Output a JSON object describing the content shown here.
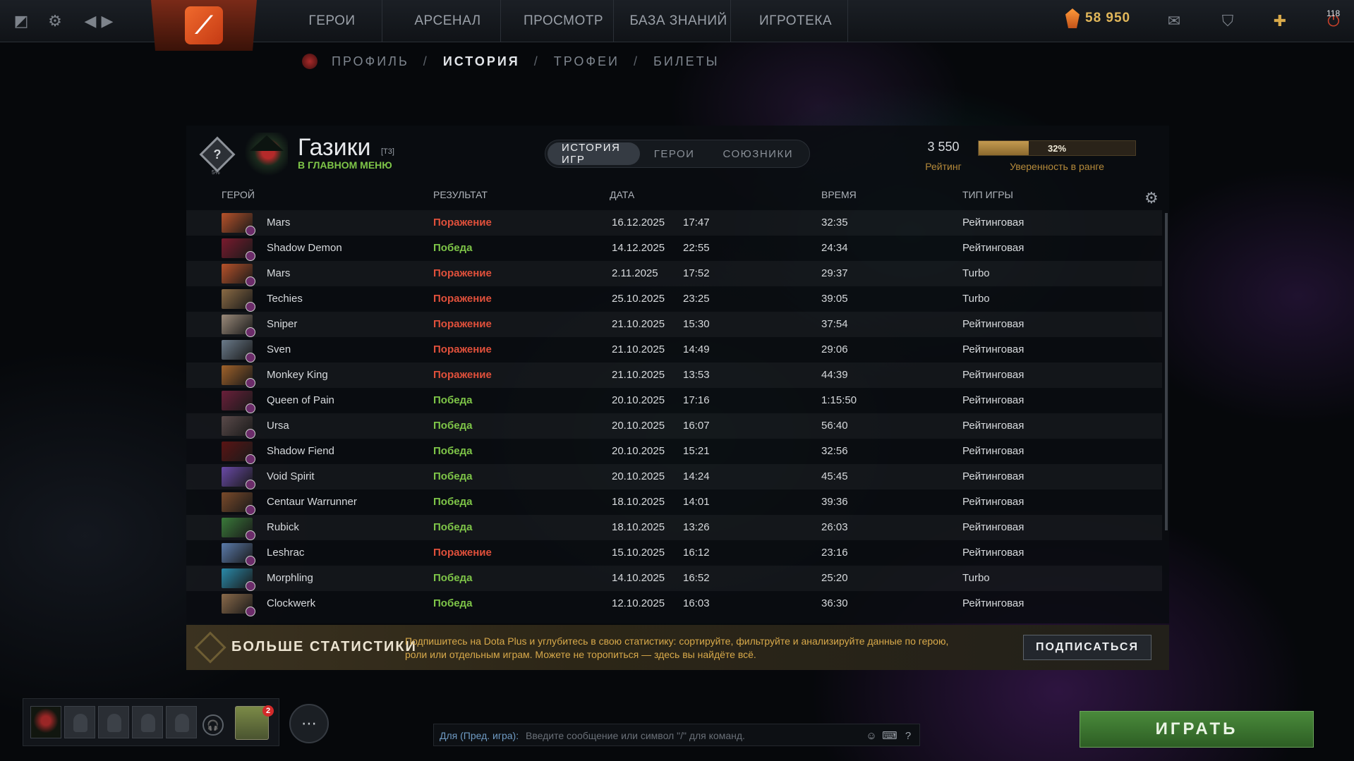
{
  "topbar": {
    "nav": [
      "ГЕРОИ",
      "АРСЕНАЛ",
      "ПРОСМОТР",
      "БАЗА ЗНАНИЙ",
      "ИГРОТЕКА"
    ],
    "shards": "58 950",
    "level": "118"
  },
  "breadcrumb": [
    "ПРОФИЛЬ",
    "ИСТОРИЯ",
    "ТРОФЕИ",
    "БИЛЕТЫ"
  ],
  "profile": {
    "name": "Газики",
    "tag": "[T3]",
    "status": "В ГЛАВНОМ МЕНЮ",
    "rank_sub": "5%",
    "rating": "3 550",
    "rating_label": "Рейтинг",
    "confidence": 0.32,
    "confidence_text": "32%",
    "confidence_label": "Уверенность в ранге"
  },
  "tabs": [
    "ИСТОРИЯ ИГР",
    "ГЕРОИ",
    "СОЮЗНИКИ"
  ],
  "table": {
    "headers": {
      "hero": "ГЕРОЙ",
      "result": "РЕЗУЛЬТАТ",
      "date": "ДАТА",
      "time": "ВРЕМЯ",
      "type": "ТИП ИГРЫ"
    },
    "rows": [
      {
        "hero": "Mars",
        "result": "Поражение",
        "win": false,
        "date": "16.12.2025",
        "clock": "17:47",
        "duration": "32:35",
        "type": "Рейтинговая",
        "color": "#b8522a"
      },
      {
        "hero": "Shadow Demon",
        "result": "Победа",
        "win": true,
        "date": "14.12.2025",
        "clock": "22:55",
        "duration": "24:34",
        "type": "Рейтинговая",
        "color": "#7a1a2e"
      },
      {
        "hero": "Mars",
        "result": "Поражение",
        "win": false,
        "date": "2.11.2025",
        "clock": "17:52",
        "duration": "29:37",
        "type": "Turbo",
        "color": "#b8522a"
      },
      {
        "hero": "Techies",
        "result": "Поражение",
        "win": false,
        "date": "25.10.2025",
        "clock": "23:25",
        "duration": "39:05",
        "type": "Turbo",
        "color": "#8a6a44"
      },
      {
        "hero": "Sniper",
        "result": "Поражение",
        "win": false,
        "date": "21.10.2025",
        "clock": "15:30",
        "duration": "37:54",
        "type": "Рейтинговая",
        "color": "#9a8a7a"
      },
      {
        "hero": "Sven",
        "result": "Поражение",
        "win": false,
        "date": "21.10.2025",
        "clock": "14:49",
        "duration": "29:06",
        "type": "Рейтинговая",
        "color": "#6a7a8a"
      },
      {
        "hero": "Monkey King",
        "result": "Поражение",
        "win": false,
        "date": "21.10.2025",
        "clock": "13:53",
        "duration": "44:39",
        "type": "Рейтинговая",
        "color": "#a0622a"
      },
      {
        "hero": "Queen of Pain",
        "result": "Победа",
        "win": true,
        "date": "20.10.2025",
        "clock": "17:16",
        "duration": "1:15:50",
        "type": "Рейтинговая",
        "color": "#6a1f3a"
      },
      {
        "hero": "Ursa",
        "result": "Победа",
        "win": true,
        "date": "20.10.2025",
        "clock": "16:07",
        "duration": "56:40",
        "type": "Рейтинговая",
        "color": "#5a4a4a"
      },
      {
        "hero": "Shadow Fiend",
        "result": "Победа",
        "win": true,
        "date": "20.10.2025",
        "clock": "15:21",
        "duration": "32:56",
        "type": "Рейтинговая",
        "color": "#5a1414"
      },
      {
        "hero": "Void Spirit",
        "result": "Победа",
        "win": true,
        "date": "20.10.2025",
        "clock": "14:24",
        "duration": "45:45",
        "type": "Рейтинговая",
        "color": "#6a4aa8"
      },
      {
        "hero": "Centaur Warrunner",
        "result": "Победа",
        "win": true,
        "date": "18.10.2025",
        "clock": "14:01",
        "duration": "39:36",
        "type": "Рейтинговая",
        "color": "#7a4a2a"
      },
      {
        "hero": "Rubick",
        "result": "Победа",
        "win": true,
        "date": "18.10.2025",
        "clock": "13:26",
        "duration": "26:03",
        "type": "Рейтинговая",
        "color": "#3a7a3a"
      },
      {
        "hero": "Leshrac",
        "result": "Поражение",
        "win": false,
        "date": "15.10.2025",
        "clock": "16:12",
        "duration": "23:16",
        "type": "Рейтинговая",
        "color": "#5a7aaa"
      },
      {
        "hero": "Morphling",
        "result": "Победа",
        "win": true,
        "date": "14.10.2025",
        "clock": "16:52",
        "duration": "25:20",
        "type": "Turbo",
        "color": "#2a8aaa"
      },
      {
        "hero": "Clockwerk",
        "result": "Победа",
        "win": true,
        "date": "12.10.2025",
        "clock": "16:03",
        "duration": "36:30",
        "type": "Рейтинговая",
        "color": "#8a6a4a"
      }
    ]
  },
  "promo": {
    "title": "БОЛЬШЕ СТАТИСТИКИ",
    "text": "Подпишитесь на Dota Plus и углубитесь в свою статистику: сортируйте, фильтруйте и анализируйте данные по герою, роли или отдельным играм. Можете не торопиться — здесь вы найдёте всё.",
    "button": "ПОДПИСАТЬСЯ"
  },
  "chat": {
    "target": "Для (Пред. игра):",
    "placeholder": "Введите сообщение или символ \"/\" для команд."
  },
  "chest_badge": "2",
  "play_button": "ИГРАТЬ"
}
